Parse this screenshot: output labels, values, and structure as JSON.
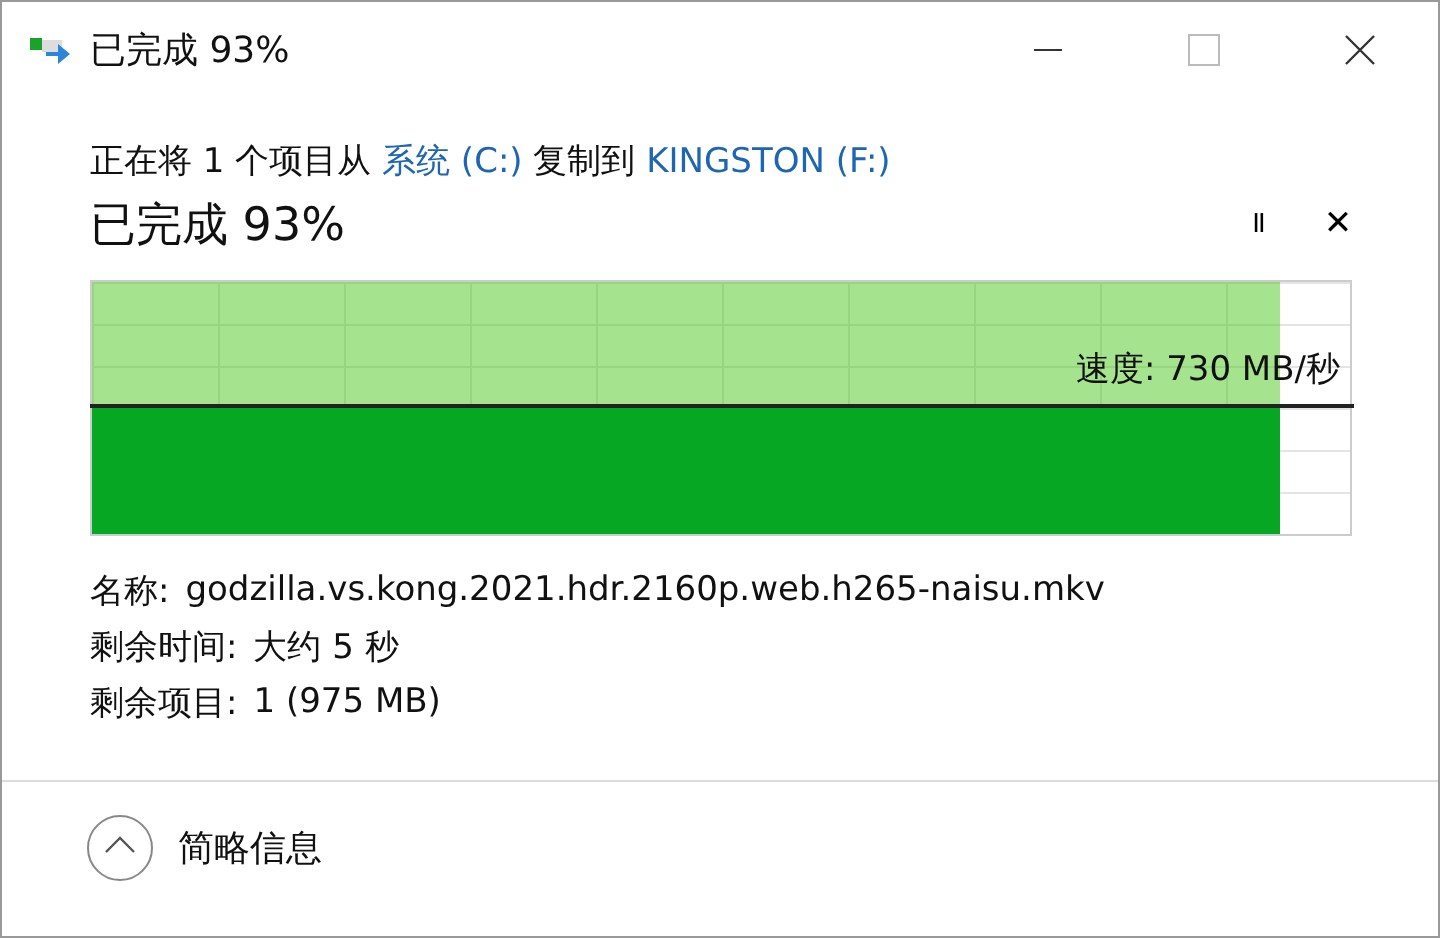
{
  "window": {
    "title": "已完成 93%"
  },
  "summary": [
    {
      "kind": "text",
      "text": "正在将 1 个项目从 "
    },
    {
      "kind": "link",
      "text": "系统 (C:)"
    },
    {
      "kind": "text",
      "text": " 复制到 "
    },
    {
      "kind": "link",
      "text": "KINGSTON (F:)"
    }
  ],
  "heading": "已完成 93%",
  "controls": {
    "pause": "II",
    "cancel": "✕"
  },
  "progress": {
    "speed": "速度: 730 MB/秒"
  },
  "details": [
    {
      "label": "名称:",
      "value": "godzilla.vs.kong.2021.hdr.2160p.web.h265-naisu.mkv"
    },
    {
      "label": "剩余时间:",
      "value": "大约 5 秒"
    },
    {
      "label": "剩余项目:",
      "value": "1 (975 MB)"
    }
  ],
  "footer": {
    "toggle": "简略信息",
    "expanded": true
  }
}
